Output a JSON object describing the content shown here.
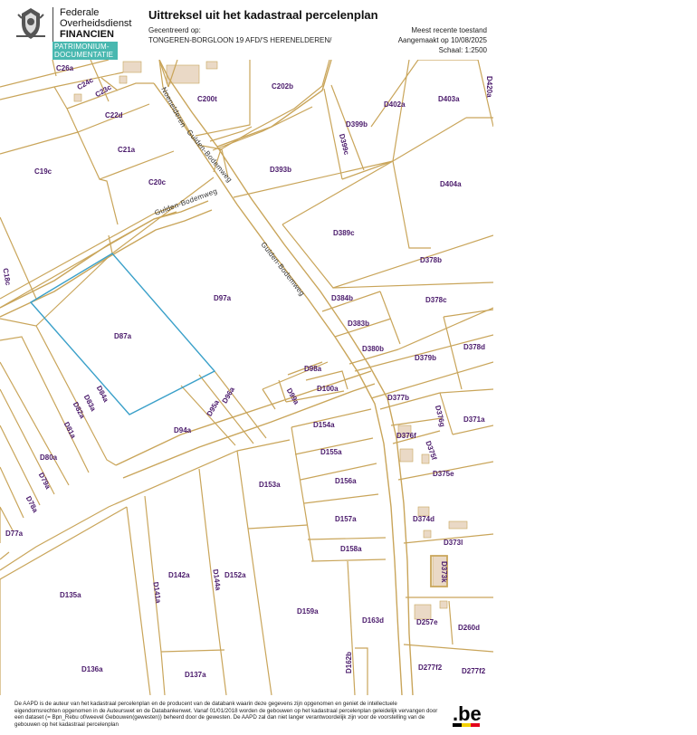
{
  "header": {
    "org_line1": "Federale",
    "org_line2": "Overheidsdienst",
    "org_line3": "FINANCIEN",
    "dept_line1": "PATRIMONIUM-",
    "dept_line2": "DOCUMENTATIE",
    "title": "Uittreksel uit het kadastraal percelenplan",
    "centered_label": "Gecentreerd op:",
    "centered_value": "TONGEREN-BORGLOON 19 AFD/'S HERENELDEREN/",
    "recent_label": "Meest recente toestand",
    "created": "Aangemaakt op 10/08/2025",
    "scale": "Schaal: 1:2500"
  },
  "colors": {
    "parcel_line": "#c9a55a",
    "parcel_label": "#4a1a6b",
    "selected_parcel": "#3aa0c9",
    "building_fill": "#ead9c6",
    "department_bar": "#49b8b0"
  },
  "streets": {
    "noenelderen": "Noenelderen",
    "gulden1": "Gulden-Bodemweg",
    "gulden2": "Gulden-Bodemweg",
    "gulden3": "Gulden-Bodemweg"
  },
  "parcels": {
    "C26a": "C26a",
    "C24c": "C24c",
    "C23c": "C23c",
    "C22d": "C22d",
    "C21a": "C21a",
    "C19c": "C19c",
    "C20c": "C20c",
    "C18c": "C18c",
    "C200t": "C200t",
    "C202b": "C202b",
    "D402a": "D402a",
    "D403a": "D403a",
    "D420a": "D420a",
    "D399b": "D399b",
    "D399c": "D399c",
    "D393b": "D393b",
    "D404a": "D404a",
    "D389c": "D389c",
    "D378b": "D378b",
    "D378c": "D378c",
    "D384b": "D384b",
    "D383b": "D383b",
    "D380b": "D380b",
    "D378d": "D378d",
    "D379b": "D379b",
    "D97a": "D97a",
    "D87a": "D87a",
    "D98a": "D98a",
    "D99a": "D99a",
    "D100a": "D100a",
    "D377b": "D377b",
    "D376g": "D376g",
    "D371a": "D371a",
    "D376f": "D376f",
    "D375f": "D375f",
    "D375e": "D375e",
    "D154a": "D154a",
    "D155a": "D155a",
    "D156a": "D156a",
    "D157a": "D157a",
    "D158a": "D158a",
    "D153a": "D153a",
    "D374d": "D374d",
    "D373l": "D373l",
    "D373k": "D373k",
    "D84a": "D84a",
    "D83a": "D83a",
    "D82a": "D82a",
    "D81a": "D81a",
    "D80a": "D80a",
    "D79a": "D79a",
    "D78a": "D78a",
    "D77a": "D77a",
    "D96a": "D96a",
    "D95a": "D95a",
    "D94a": "D94a",
    "D142a": "D142a",
    "D144a": "D144a",
    "D152a": "D152a",
    "D141a": "D141a",
    "D135a": "D135a",
    "D159a": "D159a",
    "D163d": "D163d",
    "D257e": "D257e",
    "D260d": "D260d",
    "D136a": "D136a",
    "D137a": "D137a",
    "D162b": "D162b",
    "D277f2a": "D277f2",
    "D277f2b": "D277f2"
  },
  "footer": {
    "disclaimer": "De AAPD is de auteur van het kadastraal percelenplan en de producent van de databank waarin deze gegevens zijn opgenomen en geniet de intellectuele eigendomsrechten opgenomen in de Auteurswet en de Databankenwet. Vanaf 01/01/2018 worden de gebouwen op het kadastraal percelenplan geleidelijk vervangen door een dataset (= Bpn_Rebu of/weevel Gebouwen(gewesten)) beheerd door de gewesten. De AAPD zal dan niet langer verantwoordelijk zijn voor de voorstelling van de gebouwen op het kadastraal percelenplan",
    "be_logo": ".be"
  }
}
